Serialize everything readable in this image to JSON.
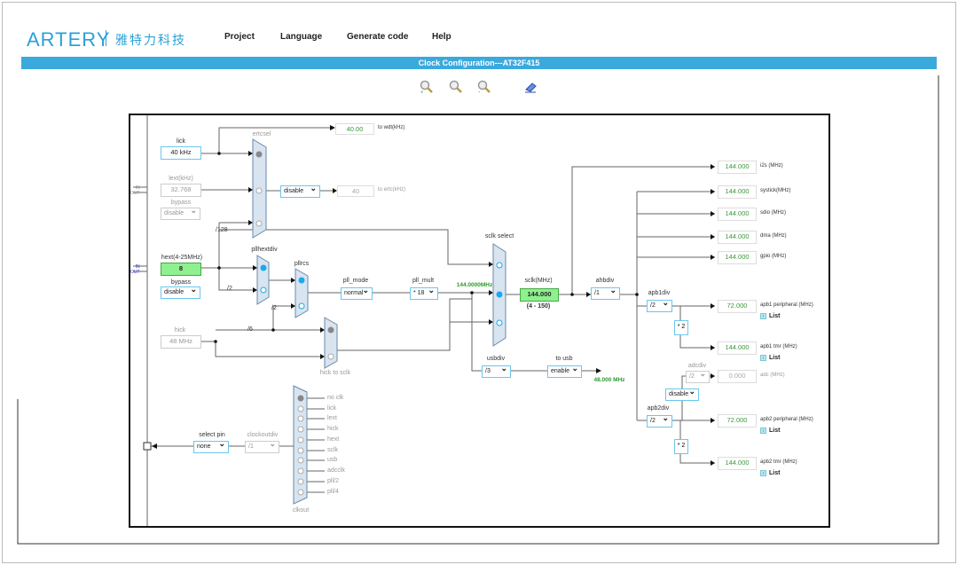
{
  "header": {
    "logo": "ARTERY",
    "logo_cn": "雅特力科技",
    "menu": [
      "Project",
      "Language",
      "Generate code",
      "Help"
    ],
    "title": "Clock Configuration---AT32F415"
  },
  "toolbar": {
    "icons": [
      "zoom-in-icon",
      "zoom-reset-icon",
      "zoom-out-icon",
      "eraser-icon"
    ]
  },
  "sources": {
    "lick": {
      "label": "lick",
      "value": "40 kHz"
    },
    "lext": {
      "label": "lext(kHz)",
      "value": "32.768",
      "bypass_label": "bypass",
      "bypass": "disable"
    },
    "hext": {
      "label": "hext(4-25MHz)",
      "value": "8",
      "bypass_label": "bypass",
      "bypass": "disable"
    },
    "hick": {
      "label": "hick",
      "value": "48 MHz"
    },
    "io_in": "IN",
    "io_out": "OUT"
  },
  "ertc": {
    "mux_label": "ertcsel",
    "enable": "disable",
    "wdt_value": "40.00",
    "wdt_label": "to wdt(kHz)",
    "ertc_value": "40",
    "ertc_label": "to ertc(kHz)",
    "div128": "/128"
  },
  "pll": {
    "hextdiv_label": "pllhextdiv",
    "rcs_label": "pllrcs",
    "div2a": "/2",
    "div2b": "/2",
    "div6": "/6",
    "mode_label": "pll_mode",
    "mode": "normal",
    "mult_label": "pll_mult",
    "mult": "* 18",
    "out": "144.0000MHz",
    "hick_to_sclk": "hick to sclk"
  },
  "sclk": {
    "select_label": "sclk select",
    "label": "sclk(MHz)",
    "value": "144.000",
    "range": "(4 - 150)",
    "ahbdiv_label": "ahbdiv",
    "ahbdiv": "/1"
  },
  "usb": {
    "div_label": "usbdiv",
    "div": "/3",
    "to_label": "to usb",
    "enable": "enable",
    "freq": "48.000 MHz"
  },
  "outputs": [
    {
      "value": "144.000",
      "label": "i2s (MHz)"
    },
    {
      "value": "144.000",
      "label": "systick(MHz)"
    },
    {
      "value": "144.000",
      "label": "sdio (MHz)"
    },
    {
      "value": "144.000",
      "label": "dma (MHz)"
    },
    {
      "value": "144.000",
      "label": "gpio (MHz)"
    },
    {
      "value": "72.000",
      "label": "apb1 peripheral (MHz)",
      "list": "List"
    },
    {
      "value": "144.000",
      "label": "apb1 tmr (MHz)",
      "list": "List"
    },
    {
      "value": "0.000",
      "label": "adc (MHz)"
    },
    {
      "value": "72.000",
      "label": "apb2 peripheral (MHz)",
      "list": "List"
    },
    {
      "value": "144.000",
      "label": "apb2 tmr (MHz)",
      "list": "List"
    }
  ],
  "apb": {
    "apb1div_label": "apb1div",
    "apb1div": "/2",
    "apb2div_label": "apb2div",
    "apb2div": "/2",
    "mul1": "* 2",
    "mul2": "* 2",
    "adcdiv_label": "adcdiv",
    "adcdiv": "/2",
    "adc_enable": "disable"
  },
  "clkout": {
    "pin_label": "select pin",
    "pin": "none",
    "div_label": "clockoutdiv",
    "div": "/1",
    "label": "clkout",
    "options": [
      "no clk",
      "lick",
      "lext",
      "hick",
      "hext",
      "sclk",
      "usb",
      "adcclk",
      "pll/2",
      "pll/4"
    ]
  }
}
